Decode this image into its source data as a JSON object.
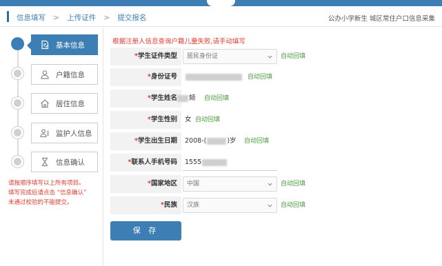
{
  "header": {
    "breadcrumbs": [
      "信息填写",
      "上传证件",
      "提交报名"
    ],
    "separator": ">",
    "right_title": "公办小学新生 城区常住户口信息采集"
  },
  "steps": [
    {
      "label": "基本信息",
      "icon": "document-edit-icon",
      "active": true
    },
    {
      "label": "户籍信息",
      "icon": "person-icon",
      "active": false
    },
    {
      "label": "居住信息",
      "icon": "home-icon",
      "active": false
    },
    {
      "label": "监护人信息",
      "icon": "guardian-icon",
      "active": false
    },
    {
      "label": "信息确认",
      "icon": "hourglass-icon",
      "active": false
    }
  ],
  "notes": [
    "请按顺序填写以上所有项目。",
    "填写完成后请点击 “信息确认”",
    "未通过校验的不能提交。"
  ],
  "form": {
    "warning": "根据注册人信息查询户籍儿童失败,请手动填写",
    "required_mark": "*",
    "auto_fill": "自动回填",
    "fields": {
      "id_type": {
        "label": "学生证件类型",
        "value": "居民身份证"
      },
      "id_number": {
        "label": "身份证号",
        "value": ""
      },
      "name": {
        "label": "学生姓名",
        "value_suffix": "颏"
      },
      "gender": {
        "label": "学生性别",
        "value": "女"
      },
      "birth": {
        "label": "学生出生日期",
        "prefix": "2008-(",
        "suffix": ")岁"
      },
      "phone": {
        "label": "联系人手机号码",
        "value": "1555"
      },
      "country": {
        "label": "国家地区",
        "value": "中国"
      },
      "ethnicity": {
        "label": "民族",
        "value": "汉族"
      }
    },
    "save_label": "保 存"
  },
  "colors": {
    "primary": "#3d7fb4",
    "warning": "#e23b2e",
    "auto_fill": "#4a9a3a"
  }
}
